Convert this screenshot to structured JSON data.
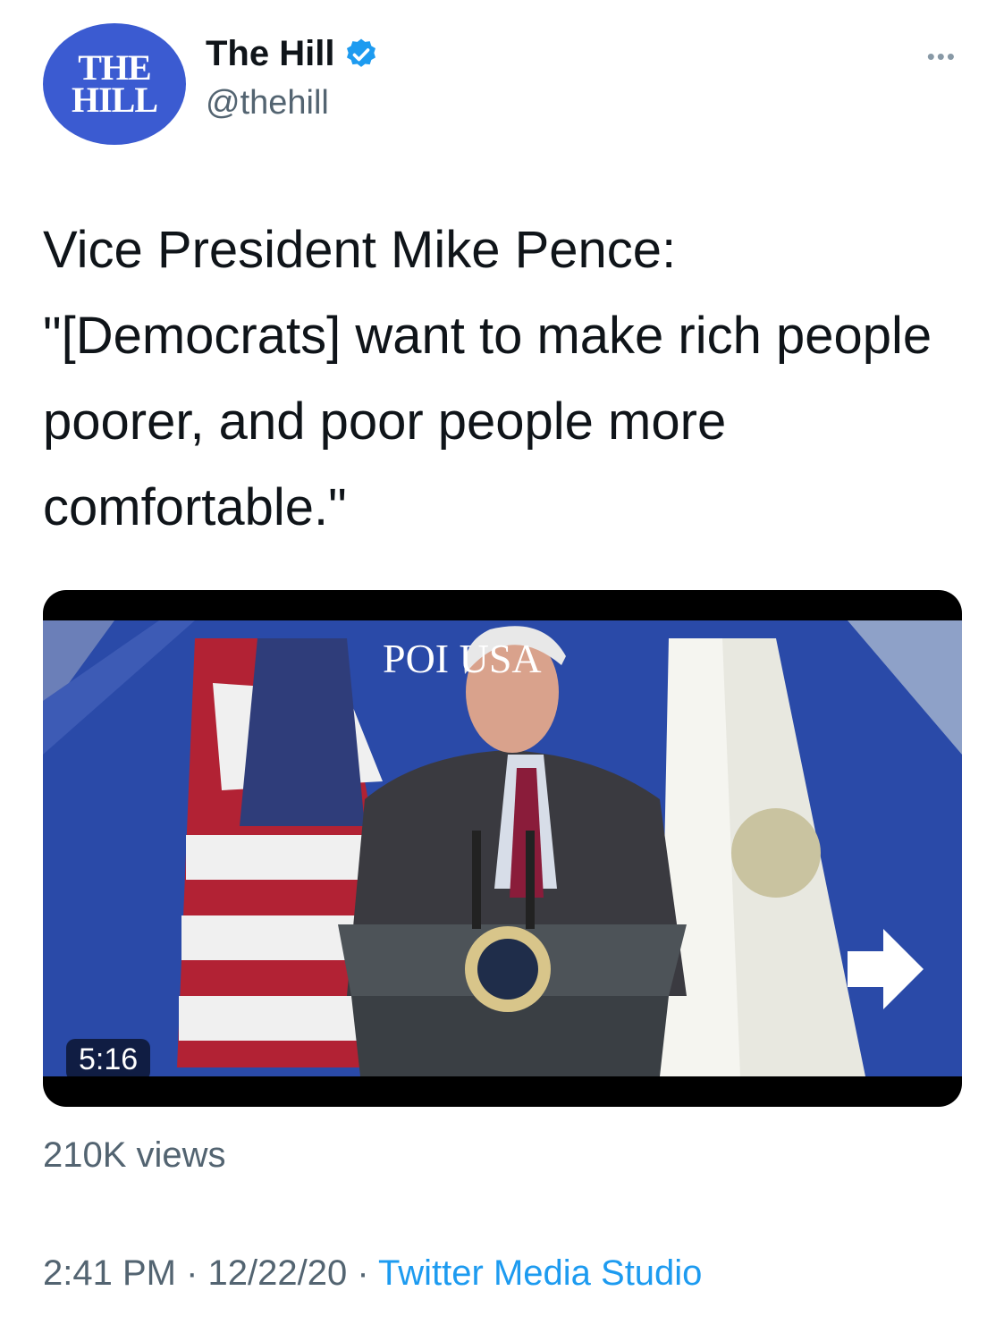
{
  "account": {
    "avatar_line1": "THE",
    "avatar_line2": "HILL",
    "name": "The Hill",
    "handle": "@thehill",
    "avatar_color": "#3b5bd1",
    "verified_color": "#1d9bf0"
  },
  "more_label": "•••",
  "tweet": {
    "text": "Vice President Mike Pence:\n\"[Democrats] want to make rich people poorer, and poor people more comfortable.\""
  },
  "video": {
    "banner_text": "POI  USA",
    "duration": "5:16"
  },
  "views": "210K views",
  "meta": {
    "time": "2:41 PM",
    "sep1": " · ",
    "date": "12/22/20",
    "sep2": " · ",
    "source": "Twitter Media Studio"
  }
}
